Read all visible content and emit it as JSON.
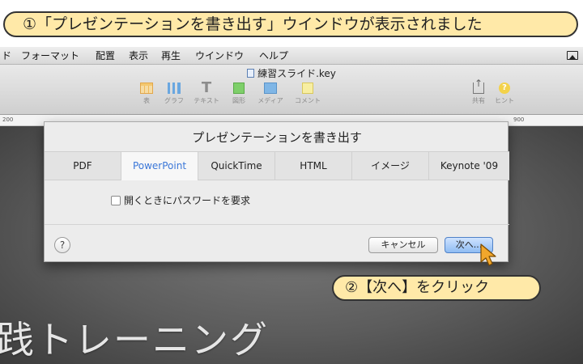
{
  "annotations": {
    "top": "①「プレゼンテーションを書き出す」ウインドウが表示されました",
    "bottom": "②【次へ】をクリック"
  },
  "menubar": {
    "items": [
      "ド",
      "フォーマット",
      "配置",
      "表示",
      "再生",
      "ウインドウ",
      "ヘルプ"
    ]
  },
  "toolbar": {
    "document_title": "練習スライド.key",
    "tools": [
      {
        "label": "表",
        "icon": "table-icon"
      },
      {
        "label": "グラフ",
        "icon": "chart-icon"
      },
      {
        "label": "テキスト",
        "icon": "text-icon"
      },
      {
        "label": "図形",
        "icon": "shape-icon"
      },
      {
        "label": "メディア",
        "icon": "media-icon"
      },
      {
        "label": "コメント",
        "icon": "comment-icon"
      }
    ],
    "share_label": "共有",
    "hint_label": "ヒント"
  },
  "ruler": {
    "left_value": "200",
    "right_value": "900"
  },
  "slide": {
    "text": "践トレーニング"
  },
  "export_dialog": {
    "title": "プレゼンテーションを書き出す",
    "tabs": [
      "PDF",
      "PowerPoint",
      "QuickTime",
      "HTML",
      "イメージ",
      "Keynote '09"
    ],
    "active_tab": "PowerPoint",
    "password_option": "開くときにパスワードを要求",
    "help_label": "?",
    "cancel_label": "キャンセル",
    "next_label": "次へ..."
  },
  "colors": {
    "callout_fill": "#ffe9a8",
    "active_tab_text": "#3b77d8",
    "primary_button": "#8fbcf3",
    "cursor": "#f2a72c"
  }
}
